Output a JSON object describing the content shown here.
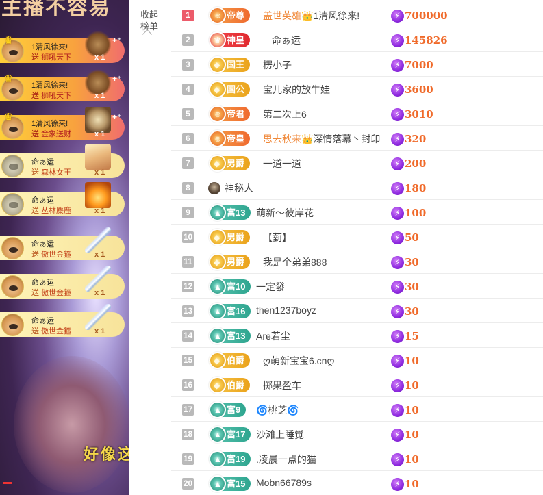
{
  "stream": {
    "title": "主播不容易",
    "subtitle": "好像这"
  },
  "gifts": [
    {
      "name": "1清风徐来!",
      "send": "送",
      "item": "狮吼天下",
      "count": "x 1",
      "style": "gold",
      "avatar": "pug",
      "crown": true,
      "icon": "lion-gift-icon"
    },
    {
      "name": "1清风徐来!",
      "send": "送",
      "item": "狮吼天下",
      "count": "x 1",
      "style": "gold",
      "avatar": "pug",
      "crown": true,
      "icon": "lion-gift-icon"
    },
    {
      "name": "1清风徐来!",
      "send": "送",
      "item": "金象送财",
      "count": "x 1",
      "style": "gold",
      "avatar": "pug",
      "crown": true,
      "icon": "deity-gift-icon"
    },
    {
      "name": "命ぁ运",
      "send": "送",
      "item": "森林女王",
      "count": "x 1",
      "style": "cream",
      "avatar": "cat",
      "crown": false,
      "icon": "fairy-gift-icon"
    },
    {
      "name": "命ぁ运",
      "send": "送",
      "item": "丛林麋鹿",
      "count": "x 1",
      "style": "cream",
      "avatar": "cat",
      "crown": false,
      "icon": "deer-gift-icon"
    },
    {
      "name": "命ぁ运",
      "send": "送",
      "item": "傲世金箍",
      "count": "x 1",
      "style": "cream",
      "avatar": "pug",
      "crown": false,
      "icon": "staff-gift-icon"
    },
    {
      "name": "命ぁ运",
      "send": "送",
      "item": "傲世金箍",
      "count": "x 1",
      "style": "cream",
      "avatar": "pug",
      "crown": false,
      "icon": "staff-gift-icon"
    },
    {
      "name": "命ぁ运",
      "send": "送",
      "item": "傲世金箍",
      "count": "x 1",
      "style": "cream",
      "avatar": "pug",
      "crown": false,
      "icon": "staff-gift-icon"
    }
  ],
  "panel": {
    "collapse_label": "收起榜单"
  },
  "ranking": [
    {
      "rank": "1",
      "badge": "帝尊",
      "badge_style": "orange",
      "name": "盖世英雄👑1清风徐来!",
      "name_style": "split",
      "name_hl": "盖世英雄👑",
      "name_rest": "1清风徐来!",
      "score": "700000"
    },
    {
      "rank": "2",
      "badge": "神皇",
      "badge_style": "red",
      "name": "命ぁ运",
      "score": "145826"
    },
    {
      "rank": "3",
      "badge": "国王",
      "badge_style": "gold",
      "name": "楞小子",
      "score": "7000"
    },
    {
      "rank": "4",
      "badge": "国公",
      "badge_style": "gold",
      "name": "宝儿家的放牛娃",
      "score": "3600"
    },
    {
      "rank": "5",
      "badge": "帝君",
      "badge_style": "orange",
      "name": "第二次上6",
      "score": "3010"
    },
    {
      "rank": "6",
      "badge": "帝皇",
      "badge_style": "orange",
      "name": "思去秋来👑深情落幕丶封印",
      "name_style": "split",
      "name_hl": "思去秋来👑",
      "name_rest": "深情落幕丶封印",
      "score": "320"
    },
    {
      "rank": "7",
      "badge": "男爵",
      "badge_style": "gold",
      "name": "一道一道",
      "score": "200"
    },
    {
      "rank": "8",
      "badge": "",
      "badge_style": "none",
      "name": "神秘人",
      "score": "180"
    },
    {
      "rank": "9",
      "badge": "富13",
      "badge_style": "teal",
      "name": "萌新～彼岸花",
      "score": "100"
    },
    {
      "rank": "10",
      "badge": "男爵",
      "badge_style": "gold",
      "name": "【菿】",
      "score": "50"
    },
    {
      "rank": "11",
      "badge": "男爵",
      "badge_style": "gold",
      "name": "我是个弟弟888",
      "score": "30"
    },
    {
      "rank": "12",
      "badge": "富10",
      "badge_style": "teal",
      "name": "一定發",
      "score": "30"
    },
    {
      "rank": "13",
      "badge": "富16",
      "badge_style": "teal",
      "name": "then1237boyz",
      "score": "30"
    },
    {
      "rank": "14",
      "badge": "富13",
      "badge_style": "teal",
      "name": "Are若尘",
      "score": "15"
    },
    {
      "rank": "15",
      "badge": "伯爵",
      "badge_style": "gold",
      "name": "ღ萌新宝宝6.cnღ",
      "score": "10"
    },
    {
      "rank": "16",
      "badge": "伯爵",
      "badge_style": "gold",
      "name": "掷果盈车",
      "score": "10"
    },
    {
      "rank": "17",
      "badge": "富9",
      "badge_style": "teal",
      "name": "🌀桃芝🌀",
      "score": "10"
    },
    {
      "rank": "18",
      "badge": "富17",
      "badge_style": "teal",
      "name": "沙滩上睡觉",
      "score": "10"
    },
    {
      "rank": "19",
      "badge": "富19",
      "badge_style": "teal",
      "name": ".凌晨一点的猫",
      "score": "10"
    },
    {
      "rank": "20",
      "badge": "富15",
      "badge_style": "teal",
      "name": "Mobn66789s",
      "score": "10"
    }
  ]
}
